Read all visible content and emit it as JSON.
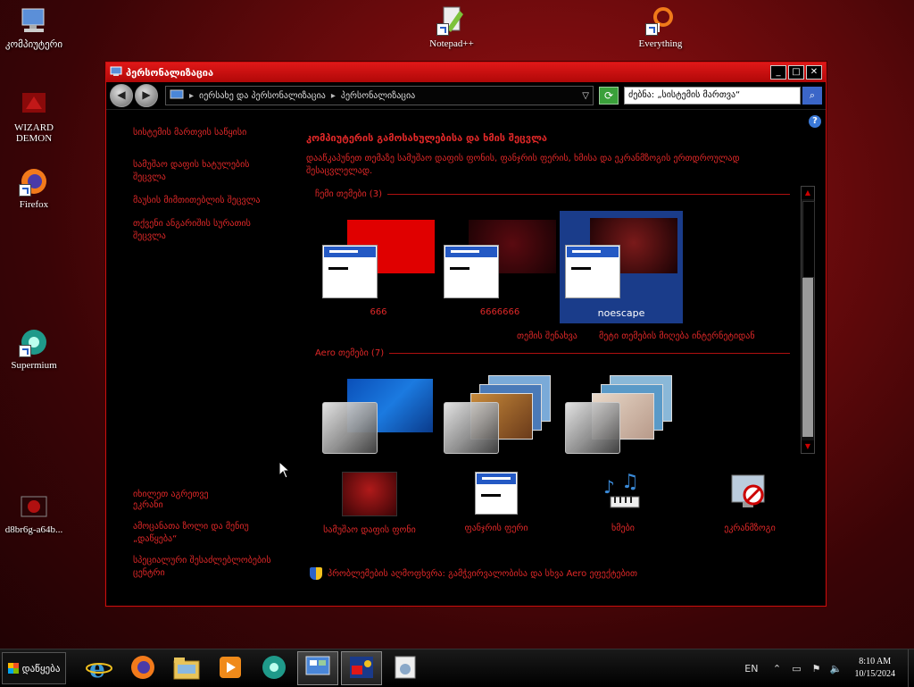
{
  "desktop": {
    "icons": [
      {
        "label": "კომპიუტერი",
        "icon": "computer-icon"
      },
      {
        "label": "WIZARD DEMON",
        "icon": "wizard-demon-icon"
      },
      {
        "label": "Firefox",
        "icon": "firefox-icon"
      },
      {
        "label": "Supermium",
        "icon": "supermium-icon"
      },
      {
        "label": "d8br6g-a64b...",
        "icon": "image-file-icon"
      },
      {
        "label": "Notepad++",
        "icon": "notepadpp-icon"
      },
      {
        "label": "Everything",
        "icon": "everything-icon"
      }
    ]
  },
  "window": {
    "title": "პერსონალიზაცია",
    "breadcrumb": [
      "იერსახე და პერსონალიზაცია",
      "პერსონალიზაცია"
    ],
    "search_value": "ძებნა: „სისტემის მართვა“",
    "left_nav": {
      "items": [
        "სისტემის მართვის საწყისი",
        "სამუშაო დაფის ხატულების შეცვლა",
        "მაუსის მიმთითებლის შეცვლა",
        "თქვენი ანგარიშის სურათის შეცვლა"
      ],
      "see_also_title": "იხილეთ აგრეთვე",
      "see_also": [
        "ეკრანი",
        "ამოცანათა ზოლი და მენიუ „დაწყება“",
        "სპეციალური შესაძლებლობების ცენტრი"
      ]
    },
    "main": {
      "heading": "კომპიუტერის გამოსახულებისა და ხმის შეცვლა",
      "description": "დააწკაპუნეთ თემაზე სამუშაო დაფის ფონის, ფანჯრის ფერის, ხმისა და ეკრანმზოგის ერთდროულად შესაცვლელად.",
      "my_themes_label": "ჩემი თემები (3)",
      "my_themes": [
        {
          "name": "666",
          "color": "#e00000",
          "selected": false
        },
        {
          "name": "6666666",
          "color": "#5a0a10",
          "selected": false
        },
        {
          "name": "noescape",
          "color": "#7a1a1a",
          "selected": true
        }
      ],
      "save_theme": "თემის შენახვა",
      "get_more_themes": "მეტი თემების მიღება ინტერნეტიდან",
      "aero_label": "Aero თემები (7)",
      "bottom_items": [
        {
          "label": "სამუშაო დაფის ფონი",
          "icon": "desktop-background-icon"
        },
        {
          "label": "ფანჯრის ფერი",
          "icon": "window-color-icon"
        },
        {
          "label": "ხმები",
          "icon": "sounds-icon"
        },
        {
          "label": "ეკრანმზოგი",
          "icon": "screensaver-icon"
        }
      ],
      "uac_text": "პრობლემების აღმოფხვრა: გამჭვირვალობისა და სხვა Aero ეფექტებით"
    }
  },
  "taskbar": {
    "start_label": "დაწყება",
    "apps": [
      "internet-explorer-icon",
      "firefox-icon",
      "explorer-icon",
      "media-player-icon",
      "supermium-icon",
      "control-panel-icon",
      "paint-icon",
      "settings-icon"
    ],
    "lang": "EN",
    "time": "8:10 AM",
    "date": "10/15/2024"
  },
  "colors": {
    "accent_red": "#e02828",
    "title_red": "#d01010",
    "selected_blue": "#1a3c8a"
  }
}
